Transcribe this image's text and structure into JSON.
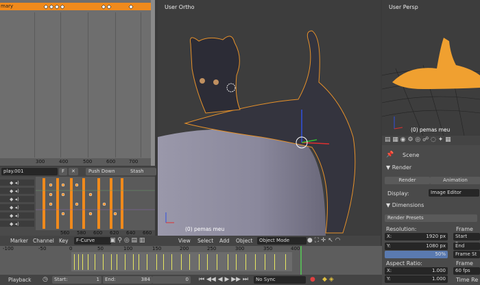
{
  "dopesheet": {
    "summary_label": "mary",
    "ruler": [
      "300",
      "400",
      "500",
      "600",
      "700"
    ]
  },
  "action_bar": {
    "action_name": "play.001",
    "f_label": "F",
    "push_down": "Push Down",
    "stash": "Stash"
  },
  "nla": {
    "ruler": [
      "560",
      "580",
      "600",
      "620",
      "640",
      "660"
    ]
  },
  "graph_header": {
    "menus": [
      "Marker",
      "Channel",
      "Key"
    ],
    "mode": "F-Curve"
  },
  "viewport": {
    "label": "User Ortho",
    "object_label": "(0) pemas meu",
    "menus": [
      "View",
      "Select",
      "Add",
      "Object"
    ],
    "mode": "Object Mode"
  },
  "persp": {
    "label": "User Persp",
    "object_label": "(0) pemas meu"
  },
  "props": {
    "scene": "Scene",
    "render_header": "Render",
    "render_btn": "Render",
    "animation_btn": "Animation",
    "display_label": "Display:",
    "display_value": "Image Editor",
    "dimensions": "Dimensions",
    "presets": "Render Presets",
    "resolution": "Resolution:",
    "res_x_label": "X:",
    "res_x": "1920 px",
    "res_y_label": "Y:",
    "res_y": "1080 px",
    "res_pct": "50%",
    "frame_range": "Frame Ran",
    "start_frame": "Start Fram",
    "end_frame": "End Fram",
    "frame_step": "Frame St",
    "aspect": "Aspect Ratio:",
    "asp_x_label": "X:",
    "asp_x": "1.000",
    "asp_y_label": "Y:",
    "asp_y": "1.000",
    "frame_rate": "Frame Rat",
    "fps": "60 fps",
    "time_rem": "Time Re"
  },
  "timeline": {
    "ticks": [
      "-100",
      "-50",
      "0",
      "50",
      "100",
      "150",
      "200",
      "250",
      "300",
      "350",
      "400"
    ]
  },
  "bottom_bar": {
    "playback": "Playback",
    "start_label": "Start:",
    "start_value": "1",
    "end_label": "End:",
    "end_value": "384",
    "current": "0",
    "sync": "No Sync"
  }
}
